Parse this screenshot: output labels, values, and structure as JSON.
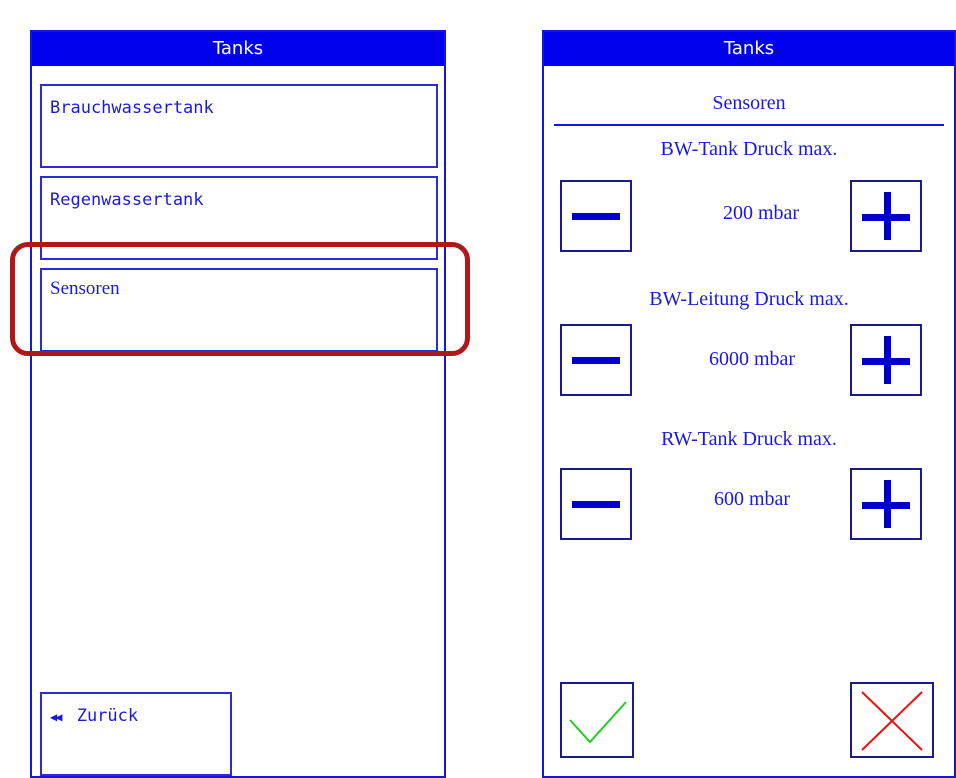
{
  "left_panel": {
    "header": "Tanks",
    "items": [
      {
        "label": "Brauchwassertank"
      },
      {
        "label": "Regenwassertank"
      },
      {
        "label": "Sensoren"
      }
    ],
    "back_label": "Zurück",
    "back_arrows": "◀◀"
  },
  "right_panel": {
    "header": "Tanks",
    "subtitle": "Sensoren",
    "settings": [
      {
        "label": "BW-Tank Druck max.",
        "value": "200 mbar"
      },
      {
        "label": "BW-Leitung Druck max.",
        "value": "6000 mbar"
      },
      {
        "label": "RW-Tank Druck max.",
        "value": "600 mbar"
      }
    ]
  },
  "colors": {
    "accent": "#0000ee",
    "highlight": "#b01818",
    "confirm": "#22cc22",
    "cancel": "#ee1111"
  },
  "icons": {
    "minus": "minus-icon",
    "plus": "plus-icon",
    "confirm": "check-icon",
    "cancel": "close-icon",
    "back": "double-left-arrow-icon"
  }
}
